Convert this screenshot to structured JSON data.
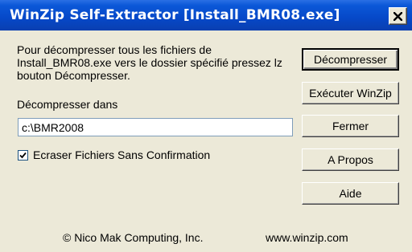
{
  "window": {
    "title": "WinZip Self-Extractor [Install_BMR08.exe]"
  },
  "content": {
    "instructions": "Pour décompresser tous les fichiers de Install_BMR08.exe vers le dossier spécifié pressez lz bouton Décompresser.",
    "destination_label": "Décompresser dans",
    "destination_value": "c:\\BMR2008",
    "overwrite_checkbox": {
      "label": "Ecraser Fichiers Sans Confirmation",
      "checked": true
    }
  },
  "buttons": {
    "decompress": "Décompresser",
    "run_winzip": "Exécuter WinZip",
    "close": "Fermer",
    "about": "A Propos",
    "help": "Aide"
  },
  "footer": {
    "copyright": "© Nico Mak Computing, Inc.",
    "website": "www.winzip.com"
  },
  "icons": {
    "close": "close-icon",
    "checkmark": "checkmark-icon"
  },
  "colors": {
    "titlebar": "#0648c8",
    "dialog_background": "#ece9d8"
  }
}
